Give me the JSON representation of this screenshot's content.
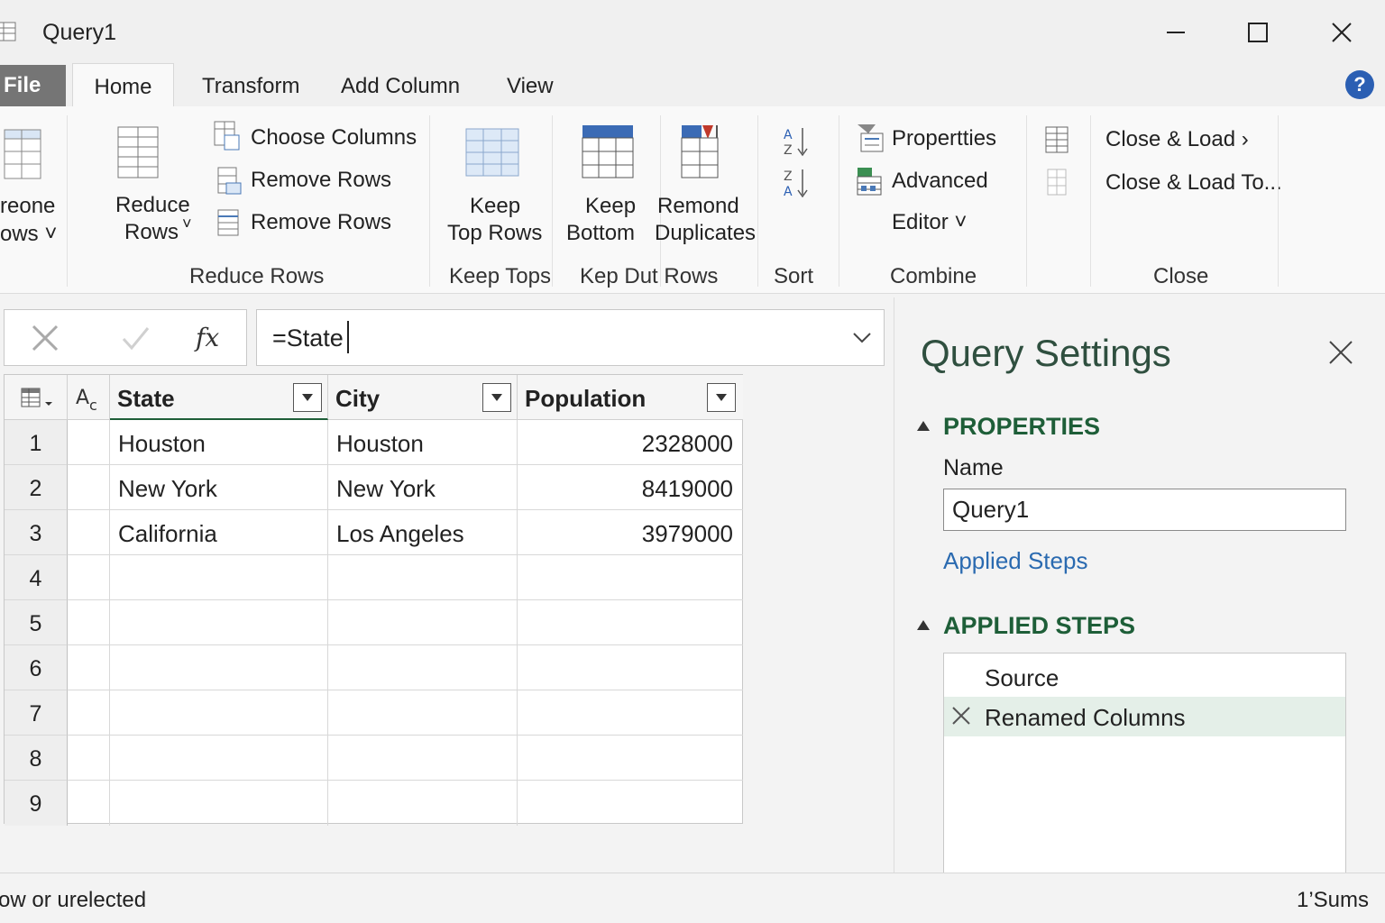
{
  "window": {
    "title": "Query1"
  },
  "tabs": {
    "file": "File",
    "home": "Home",
    "transform": "Transform",
    "add_column": "Add Column",
    "view": "View",
    "help": "?"
  },
  "ribbon": {
    "partial_btn_line1": "reone",
    "partial_btn_line2": "ows ˅",
    "reduce_rows_line1": "Reduce",
    "reduce_rows_line2": "Rows",
    "reduce_rows_arrow": "˅",
    "choose_columns": "Choose Columns",
    "remove_rows_1": "Remove Rows",
    "remove_rows_2": "Remove Rows",
    "group_reduce_rows": "Reduce Rows",
    "keep_top_line1": "Keep",
    "keep_top_line2": "Top Rows",
    "group_keep_tops": "Keep Tops",
    "keep_bottom_line1": "Keep",
    "keep_bottom_line2": "Bottom",
    "remond_line1": "Remond",
    "remond_line2": "Duplicates",
    "group_kep_dut": "Kep  Dut Rows",
    "group_sort": "Sort",
    "properties": "Propertties",
    "advanced": "Advanced",
    "editor": "Editor ˅",
    "group_combine": "Combine",
    "close_load": "Close & Load ›",
    "close_load_to": "Close & Load To...",
    "group_close": "Close"
  },
  "formula_bar": {
    "value": "=State"
  },
  "table": {
    "columns": [
      "State",
      "City",
      "Population"
    ],
    "row_numbers": [
      "1",
      "2",
      "3",
      "4",
      "5",
      "6",
      "7",
      "8",
      "9"
    ],
    "rows": [
      [
        "Houston",
        "Houston",
        "2328000"
      ],
      [
        "New York",
        "New York",
        "8419000"
      ],
      [
        "California",
        "Los Angeles",
        "3979000"
      ],
      [
        "",
        "",
        ""
      ],
      [
        "",
        "",
        ""
      ],
      [
        "",
        "",
        ""
      ],
      [
        "",
        "",
        ""
      ],
      [
        "",
        "",
        ""
      ],
      [
        "",
        "",
        ""
      ]
    ]
  },
  "query_settings": {
    "title": "Query Settings",
    "properties_header": "PROPERTIES",
    "name_label": "Name",
    "name_value": "Query1",
    "applied_steps_link": "Applied Steps",
    "applied_steps_header": "APPLIED STEPS",
    "steps": [
      "Source",
      "Renamed Columns"
    ]
  },
  "status": {
    "left": "ow or urelected",
    "right": "1’Sums"
  },
  "colors": {
    "accent_green": "#1e5e38",
    "link_blue": "#2a6ab0",
    "file_tab": "#757575",
    "selected_step": "#e4efe8"
  }
}
